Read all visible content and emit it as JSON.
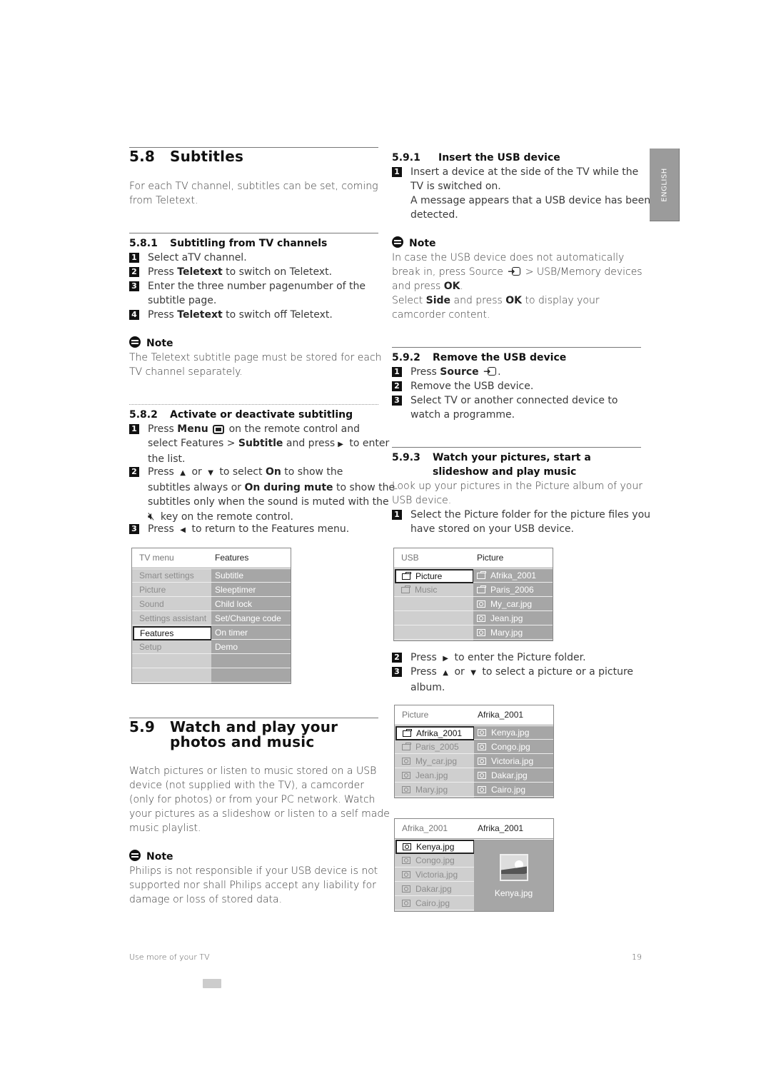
{
  "sidebar_tab": {
    "label": "ENGLISH"
  },
  "s58": {
    "number": "5.8",
    "title": "Subtitles",
    "intro": "For each TV channel, subtitles can be set, coming from Teletext.",
    "s581": {
      "number": "5.8.1",
      "title": "Subtitling from TV channels",
      "steps": [
        {
          "n": "1",
          "parts": [
            "Select aTV channel."
          ]
        },
        {
          "n": "2",
          "pre": "Press ",
          "bold": "Teletext",
          "post": " to switch on Teletext."
        },
        {
          "n": "3",
          "line1": "Enter the three number pagenumber of the",
          "line2": "subtitle page."
        },
        {
          "n": "4",
          "pre": "Press ",
          "bold": "Teletext",
          "post": " to switch off Teletext."
        }
      ],
      "note_label": "Note",
      "note_line1": "The Teletext subtitle page must be stored for each",
      "note_line2": "TV channel separately."
    },
    "s582": {
      "number": "5.8.2",
      "title": "Activate or deactivate subtitling",
      "step1": {
        "n": "1",
        "press": "Press ",
        "menu": "Menu",
        "l1_post": " on the remote control and",
        "l2_pre": "select Features > ",
        "subtitle": "Subtitle",
        "l2_post": " and press",
        "l2_end": " to enter",
        "l3": "the list."
      },
      "step2": {
        "n": "2",
        "press": "Press ",
        "or": " or ",
        "l1_mid": " to select ",
        "on": "On",
        "l1_post": " to show the",
        "l2_pre": "subtitles always or ",
        "ondm": "On during mute",
        "l2_post": " to show the",
        "l3": "subtitles only when the sound is muted with the",
        "l4": " key on the remote control."
      },
      "step3": {
        "n": "3",
        "press": "Press ",
        "post": " to return to the Features menu."
      }
    },
    "tv_menu": {
      "header_left": "TV menu",
      "header_right": "Features",
      "left_items": [
        "Smart settings",
        "Picture",
        "Sound",
        "Settings assistant",
        "Features",
        "Setup",
        "",
        ""
      ],
      "selected_left": "Features",
      "right_items": [
        "Subtitle",
        "Sleeptimer",
        "Child lock",
        "Set/Change code",
        "On timer",
        "Demo",
        "",
        ""
      ]
    }
  },
  "s59": {
    "number": "5.9",
    "title_line1": "Watch and play your",
    "title_line2": "photos and music",
    "intro_lines": [
      "Watch pictures or listen to music stored on a USB",
      "device (not supplied with the TV), a camcorder",
      "(only for photos) or from your PC network. Watch",
      "your pictures as a slideshow or listen to a self made",
      "music playlist."
    ],
    "note_label": "Note",
    "note_lines": [
      "Philips is not responsible if your USB device is not",
      "supported nor shall Philips accept any liability for",
      "damage or loss of stored data."
    ]
  },
  "s591": {
    "number": "5.9.1",
    "title": "Insert the USB device",
    "step1": {
      "n": "1",
      "lines": [
        "Insert a device at the side of the TV while the",
        "TV is switched on.",
        "A message appears that a USB device has been",
        "detected."
      ]
    },
    "note_label": "Note",
    "note": {
      "l1": "In case the USB device does not automatically",
      "l2_pre": "break in, press Source ",
      "l2_post": " > USB/Memory devices",
      "l3_pre": "and press ",
      "ok": "OK",
      "l3_post": ".",
      "l4_pre": "Select ",
      "side": "Side",
      "l4_mid": " and press ",
      "l4_post": " to display your",
      "l5": "camcorder content."
    }
  },
  "s592": {
    "number": "5.9.2",
    "title": "Remove the USB device",
    "steps": [
      {
        "n": "1",
        "pre": "Press ",
        "bold": "Source",
        "post": "."
      },
      {
        "n": "2",
        "text": "Remove the USB device."
      },
      {
        "n": "3",
        "line1": "Select TV or another connected device to",
        "line2": "watch a programme."
      }
    ]
  },
  "s593": {
    "number": "5.9.3",
    "title_line1": "Watch your pictures, start a",
    "title_line2": "slideshow and play music",
    "intro_line1": "Look up your pictures in the Picture album of your",
    "intro_line2": "USB device.",
    "step1": {
      "n": "1",
      "line1": "Select the Picture folder for the picture files you",
      "line2": "have stored on your USB device."
    },
    "step2": {
      "n": "2",
      "pre": "Press ",
      "post": " to enter the Picture folder."
    },
    "step3": {
      "n": "3",
      "pre": "Press ",
      "or": " or ",
      "post": " to select a picture or a picture",
      "line2": "album."
    }
  },
  "usb_menu": {
    "header_left": "USB",
    "header_right": "Picture",
    "left_items": [
      {
        "icon": "folder",
        "label": "Picture",
        "selected": true
      },
      {
        "icon": "folder",
        "label": "Music"
      },
      {
        "icon": "",
        "label": ""
      },
      {
        "icon": "",
        "label": ""
      },
      {
        "icon": "",
        "label": ""
      }
    ],
    "right_items": [
      {
        "icon": "folder",
        "label": "Afrika_2001"
      },
      {
        "icon": "camera",
        "label": "Paris_2006",
        "icon_override": "folder"
      },
      {
        "icon": "camera",
        "label": "My_car.jpg"
      },
      {
        "icon": "camera",
        "label": "Jean.jpg"
      },
      {
        "icon": "camera",
        "label": "Mary.jpg"
      }
    ]
  },
  "picture_menu": {
    "header_left": "Picture",
    "header_right": "Afrika_2001",
    "left_items": [
      {
        "icon": "folder",
        "label": "Afrika_2001",
        "selected": true
      },
      {
        "icon": "folder",
        "label": "Paris_2005"
      },
      {
        "icon": "camera",
        "label": "My_car.jpg"
      },
      {
        "icon": "camera",
        "label": "Jean.jpg"
      },
      {
        "icon": "camera",
        "label": "Mary.jpg"
      }
    ],
    "right_items": [
      {
        "icon": "camera",
        "label": "Kenya.jpg"
      },
      {
        "icon": "camera",
        "label": "Congo.jpg"
      },
      {
        "icon": "camera",
        "label": "Victoria.jpg"
      },
      {
        "icon": "camera",
        "label": "Dakar.jpg"
      },
      {
        "icon": "camera",
        "label": "Cairo.jpg"
      }
    ]
  },
  "album_menu": {
    "header_left": "Afrika_2001",
    "header_right": "Afrika_2001",
    "left_items": [
      {
        "icon": "camera",
        "label": "Kenya.jpg",
        "selected": true
      },
      {
        "icon": "camera",
        "label": "Congo.jpg"
      },
      {
        "icon": "camera",
        "label": "Victoria.jpg"
      },
      {
        "icon": "camera",
        "label": "Dakar.jpg"
      },
      {
        "icon": "camera",
        "label": "Cairo.jpg"
      }
    ],
    "preview_label": "Kenya.jpg"
  },
  "footer": {
    "section": "Use more of your TV",
    "page_number": "19"
  }
}
